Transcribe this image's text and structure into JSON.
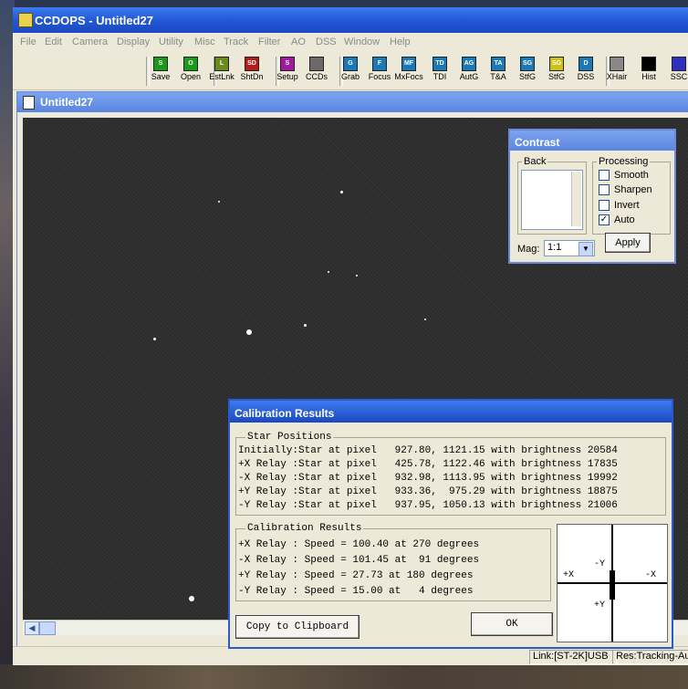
{
  "app": {
    "title": "CCDOPS - Untitled27"
  },
  "menu": [
    "File",
    "Edit",
    "Camera",
    "Display",
    "Utility",
    "Misc",
    "Track",
    "Filter",
    "AO",
    "DSS",
    "Window",
    "Help"
  ],
  "toolbar": [
    {
      "label": "Save",
      "icon": "save-icon",
      "glyph": "S",
      "color": "#1a9a1a"
    },
    {
      "label": "Open",
      "icon": "open-icon",
      "glyph": "O",
      "color": "#1a9a1a"
    },
    {
      "label": "EstLnk",
      "icon": "establish-link-icon",
      "glyph": "L",
      "color": "#6a8a1a"
    },
    {
      "label": "ShtDn",
      "icon": "shutdown-icon",
      "glyph": "SD",
      "color": "#b81a1a"
    },
    {
      "label": "Setup",
      "icon": "setup-icon",
      "glyph": "S",
      "color": "#a01aa0"
    },
    {
      "label": "CCDs",
      "icon": "ccds-icon",
      "glyph": "",
      "color": "#6a6a6a"
    },
    {
      "label": "Grab",
      "icon": "grab-icon",
      "glyph": "G",
      "color": "#1a7ab8"
    },
    {
      "label": "Focus",
      "icon": "focus-icon",
      "glyph": "F",
      "color": "#1a7ab8"
    },
    {
      "label": "MxFocs",
      "icon": "max-focus-icon",
      "glyph": "MF",
      "color": "#1a7ab8"
    },
    {
      "label": "TDI",
      "icon": "tdi-icon",
      "glyph": "TD",
      "color": "#1a7ab8"
    },
    {
      "label": "AutG",
      "icon": "autoguide-icon",
      "glyph": "AG",
      "color": "#1a7ab8"
    },
    {
      "label": "T&A",
      "icon": "track-accumulate-icon",
      "glyph": "TA",
      "color": "#1a7ab8"
    },
    {
      "label": "StfG",
      "icon": "self-guide-icon",
      "glyph": "SG",
      "color": "#1a7ab8"
    },
    {
      "label": "StfG",
      "icon": "self-guide-2-icon",
      "glyph": "SG",
      "color": "#d0c010"
    },
    {
      "label": "DSS",
      "icon": "dss-icon",
      "glyph": "D",
      "color": "#1a7ab8"
    },
    {
      "label": "XHair",
      "icon": "crosshair-icon",
      "glyph": "",
      "color": "#888888"
    },
    {
      "label": "Hist",
      "icon": "histogram-icon",
      "glyph": "",
      "color": "#000000"
    },
    {
      "label": "SSC",
      "icon": "color-icon",
      "glyph": "",
      "color": "#3030c0"
    }
  ],
  "image_window": {
    "title": "Untitled27"
  },
  "contrast": {
    "title": "Contrast",
    "back_label": "Back",
    "processing_label": "Processing",
    "options": [
      {
        "label": "Smooth",
        "checked": false
      },
      {
        "label": "Sharpen",
        "checked": false
      },
      {
        "label": "Invert",
        "checked": false
      },
      {
        "label": "Auto",
        "checked": true
      }
    ],
    "mag_label": "Mag:",
    "mag_value": "1:1",
    "apply_label": "Apply"
  },
  "calibration": {
    "title": "Calibration Results",
    "star_positions_label": "Star Positions",
    "star_rows": [
      "Initially:Star at pixel   927.80, 1121.15 with brightness 20584",
      "+X Relay :Star at pixel   425.78, 1122.46 with brightness 17835",
      "-X Relay :Star at pixel   932.98, 1113.95 with brightness 19992",
      "+Y Relay :Star at pixel   933.36,  975.29 with brightness 18875",
      "-Y Relay :Star at pixel   937.95, 1050.13 with brightness 21006"
    ],
    "results_label": "Calibration Results",
    "result_rows": [
      "+X Relay : Speed = 100.40 at 270 degrees",
      "-X Relay : Speed = 101.45 at  91 degrees",
      "+Y Relay : Speed = 27.73 at 180 degrees",
      "-Y Relay : Speed = 15.00 at   4 degrees"
    ],
    "plot_labels": {
      "px": "+X",
      "mx": "-X",
      "py": "+Y",
      "my": "-Y"
    },
    "copy_label": "Copy to Clipboard",
    "ok_label": "OK"
  },
  "status": {
    "link": "Link:[ST-2K]USB",
    "res": "Res:Tracking-Au"
  }
}
